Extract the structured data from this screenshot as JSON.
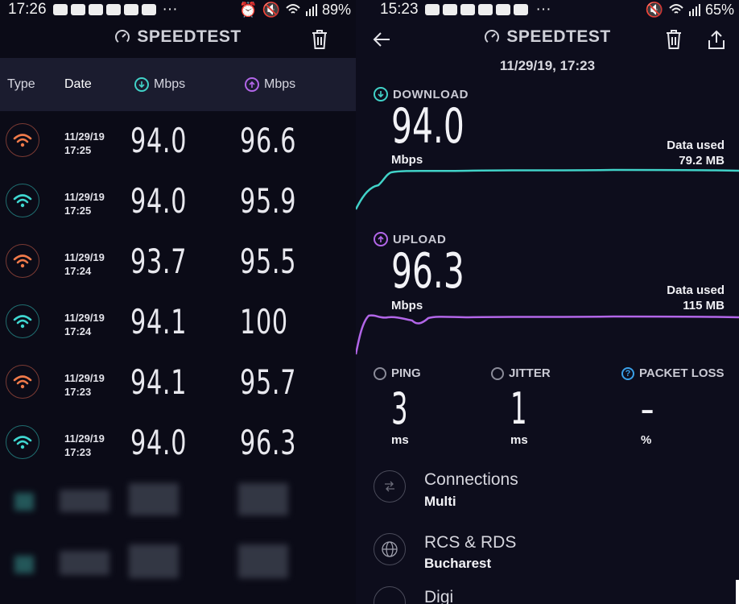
{
  "left": {
    "status": {
      "time": "17:26",
      "dots": "···",
      "battery": "89%"
    },
    "brand": "SPEEDTEST",
    "columns": {
      "type": "Type",
      "date": "Date",
      "download": "Mbps",
      "upload": "Mbps"
    },
    "rows": [
      {
        "date": "11/29/19",
        "time": "17:25",
        "download": "94.0",
        "upload": "96.6",
        "color": "orange"
      },
      {
        "date": "11/29/19",
        "time": "17:25",
        "download": "94.0",
        "upload": "95.9",
        "color": "teal"
      },
      {
        "date": "11/29/19",
        "time": "17:24",
        "download": "93.7",
        "upload": "95.5",
        "color": "orange"
      },
      {
        "date": "11/29/19",
        "time": "17:24",
        "download": "94.1",
        "upload": "100",
        "color": "teal"
      },
      {
        "date": "11/29/19",
        "time": "17:23",
        "download": "94.1",
        "upload": "95.7",
        "color": "orange"
      },
      {
        "date": "11/29/19",
        "time": "17:23",
        "download": "94.0",
        "upload": "96.3",
        "color": "teal"
      }
    ]
  },
  "right": {
    "status": {
      "time": "15:23",
      "dots": "···",
      "battery": "65%"
    },
    "brand": "SPEEDTEST",
    "datetime": "11/29/19, 17:23",
    "download": {
      "label": "DOWNLOAD",
      "value": "94.0",
      "unit": "Mbps",
      "data_used_label": "Data used",
      "data_used": "79.2 MB"
    },
    "upload": {
      "label": "UPLOAD",
      "value": "96.3",
      "unit": "Mbps",
      "data_used_label": "Data used",
      "data_used": "115 MB"
    },
    "ping": {
      "label": "PING",
      "value": "3",
      "unit": "ms"
    },
    "jitter": {
      "label": "JITTER",
      "value": "1",
      "unit": "ms"
    },
    "packet_loss": {
      "label": "PACKET LOSS",
      "value": "–",
      "unit": "%"
    },
    "connections": {
      "title": "Connections",
      "value": "Multi"
    },
    "provider": {
      "title": "RCS & RDS",
      "value": "Bucharest"
    },
    "server": {
      "title": "Digi"
    }
  },
  "colors": {
    "background": "#0b0b17",
    "download": "#41d2c8",
    "upload": "#b266e8",
    "orange": "#f07a4a",
    "teal": "#3fd6d0"
  }
}
